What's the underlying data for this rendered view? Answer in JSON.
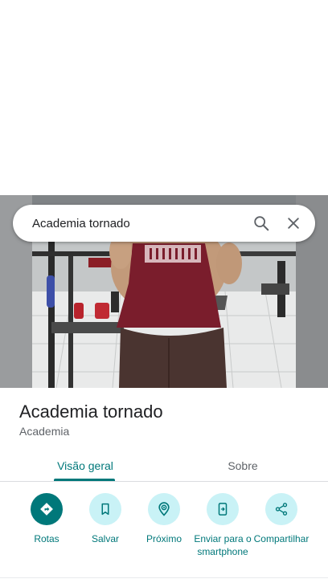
{
  "search": {
    "query": "Academia tornado"
  },
  "place": {
    "name": "Academia tornado",
    "category": "Academia"
  },
  "tabs": [
    {
      "label": "Visão geral",
      "active": true
    },
    {
      "label": "Sobre",
      "active": false
    }
  ],
  "actions": [
    {
      "label": "Rotas",
      "icon": "directions-icon"
    },
    {
      "label": "Salvar",
      "icon": "bookmark-icon"
    },
    {
      "label": "Próximo",
      "icon": "nearby-icon"
    },
    {
      "label": "Enviar para o smartphone",
      "icon": "send-to-phone-icon"
    },
    {
      "label": "Compartilhar",
      "icon": "share-icon"
    }
  ],
  "colors": {
    "accent": "#00787a",
    "action_bg": "#c9f2f6",
    "tab_inactive": "#5f6368"
  }
}
